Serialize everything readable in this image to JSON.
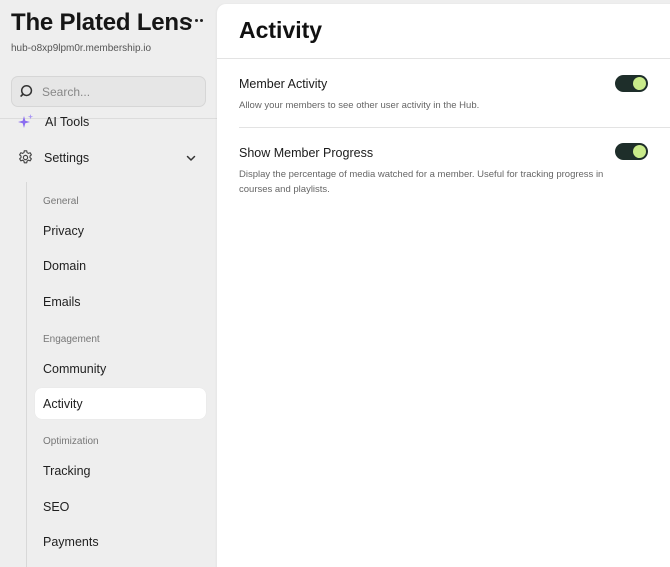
{
  "sidebar": {
    "hub_name": "The Plated Lens",
    "hub_domain": "hub-o8xp9lpm0r.membership.io",
    "search_placeholder": "Search...",
    "ai_tools_label": "AI Tools",
    "settings_label": "Settings",
    "groups": {
      "general": "General",
      "engagement": "Engagement",
      "optimization": "Optimization"
    },
    "items": {
      "privacy": "Privacy",
      "domain": "Domain",
      "emails": "Emails",
      "community": "Community",
      "activity": "Activity",
      "tracking": "Tracking",
      "seo": "SEO",
      "payments": "Payments"
    },
    "active_item": "activity"
  },
  "main": {
    "title": "Activity",
    "settings": [
      {
        "title": "Member Activity",
        "description": "Allow your members to see other user activity in the Hub.",
        "enabled": true
      },
      {
        "title": "Show Member Progress",
        "description": "Display the percentage of media watched for a member. Useful for tracking progress in courses and playlists.",
        "enabled": true
      }
    ]
  },
  "colors": {
    "toggle_track": "#1e2e2a",
    "toggle_knob": "#c9eb8a",
    "sidebar_bg": "#eeeeee",
    "ai_icon": "#8a6cf0"
  },
  "icons": {
    "more": "more-horizontal-icon",
    "search": "search-icon",
    "ai_tools": "sparkle-icon",
    "settings": "gear-icon",
    "expand": "chevron-down-icon"
  }
}
